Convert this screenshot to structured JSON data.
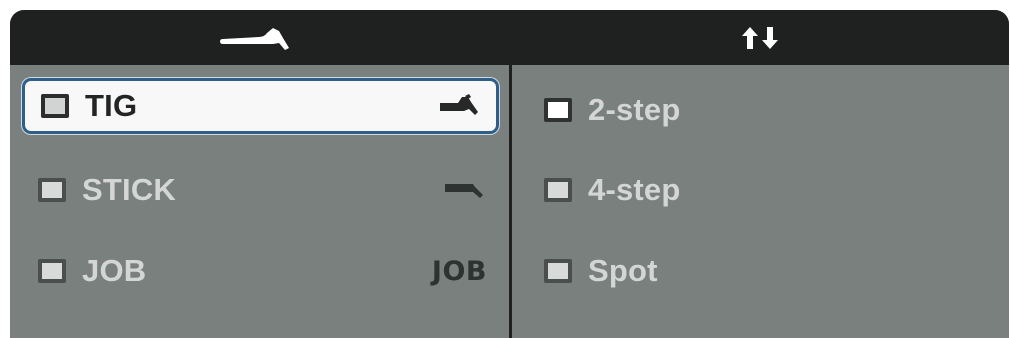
{
  "header": {
    "left_icon": "torch-icon",
    "right_icon": "up-down-arrows-icon",
    "background": "#1f2120"
  },
  "process": {
    "items": [
      {
        "label": "TIG",
        "icon": "torch-icon",
        "selected": true
      },
      {
        "label": "STICK",
        "icon": "stick-electrode-icon",
        "selected": false
      },
      {
        "label": "JOB",
        "icon_text": "JOB",
        "selected": false
      }
    ]
  },
  "trigger": {
    "items": [
      {
        "label": "2-step",
        "active": true
      },
      {
        "label": "4-step",
        "active": false
      },
      {
        "label": "Spot",
        "active": false
      }
    ]
  },
  "colors": {
    "panel": "#7a807e",
    "selection_border": "#2f5f88",
    "selection_fill": "#f8f8f8"
  }
}
